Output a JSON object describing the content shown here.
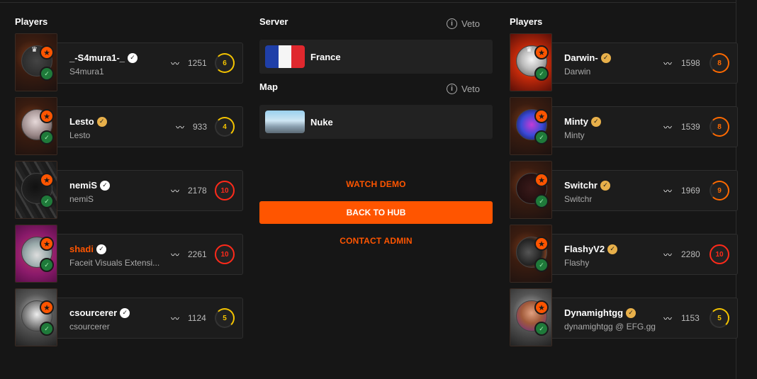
{
  "headers": {
    "left_title": "Players",
    "right_title": "Players",
    "server_label": "Server",
    "map_label": "Map",
    "veto_label": "Veto"
  },
  "server": {
    "name": "France"
  },
  "map": {
    "name": "Nuke"
  },
  "actions": {
    "watch_demo": "WATCH DEMO",
    "back_to_hub": "BACK TO HUB",
    "contact_admin": "CONTACT ADMIN"
  },
  "colors": {
    "accent": "#ff5500",
    "background": "#161616",
    "card": "#1c1c1c",
    "verified_gold": "#e8b04a",
    "level_yellow": "#f5c400",
    "level_orange": "#ff6a00",
    "level_red": "#ff2a1a"
  },
  "left_players": [
    {
      "name": "_-S4mura1-_",
      "sub": "S4mura1",
      "elo": "1251",
      "level": "6",
      "verified": "white",
      "name_color": "white"
    },
    {
      "name": "Lesto",
      "sub": "Lesto",
      "elo": "933",
      "level": "4",
      "verified": "gold",
      "name_color": "white"
    },
    {
      "name": "nemiS",
      "sub": "nemiS",
      "elo": "2178",
      "level": "10",
      "verified": "white",
      "name_color": "white"
    },
    {
      "name": "shadi",
      "sub": "Faceit Visuals Extensi...",
      "elo": "2261",
      "level": "10",
      "verified": "white",
      "name_color": "orange"
    },
    {
      "name": "csourcerer",
      "sub": "csourcerer",
      "elo": "1124",
      "level": "5",
      "verified": "white",
      "name_color": "white"
    }
  ],
  "right_players": [
    {
      "name": "Darwin-",
      "sub": "Darwin",
      "elo": "1598",
      "level": "8",
      "verified": "gold",
      "name_color": "white"
    },
    {
      "name": "Minty",
      "sub": "Minty",
      "elo": "1539",
      "level": "8",
      "verified": "gold",
      "name_color": "white"
    },
    {
      "name": "Switchr",
      "sub": "Switchr",
      "elo": "1969",
      "level": "9",
      "verified": "gold",
      "name_color": "white"
    },
    {
      "name": "FlashyV2",
      "sub": "Flashy",
      "elo": "2280",
      "level": "10",
      "verified": "gold",
      "name_color": "white"
    },
    {
      "name": "Dynamightgg",
      "sub": "dynamightgg @ EFG.gg",
      "elo": "1153",
      "level": "5",
      "verified": "gold",
      "name_color": "white"
    }
  ]
}
